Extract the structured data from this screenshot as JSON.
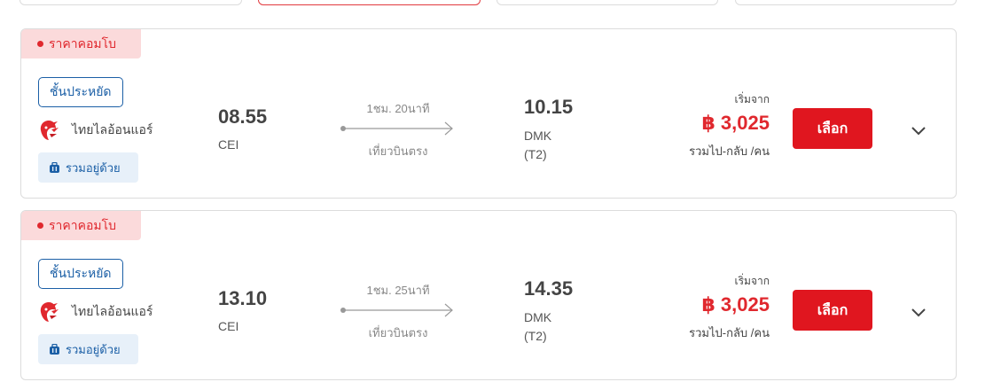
{
  "tabs": [
    {
      "state": "inactive"
    },
    {
      "state": "active"
    },
    {
      "state": "inactive"
    },
    {
      "state": "inactive"
    }
  ],
  "flights": [
    {
      "badge": "ราคาคอมโบ",
      "fare_class": "ชั้นประหยัด",
      "airline": "ไทยไลอ้อนแอร์",
      "airline_icon": "lion-air-logo",
      "baggage": "รวมอยู่ด้วย",
      "baggage_icon": "luggage-icon",
      "departure": {
        "time": "08.55",
        "code": "CEI"
      },
      "duration": "1ชม. 20นาที",
      "stops": "เที่ยวบินตรง",
      "arrival": {
        "time": "10.15",
        "code": "DMK",
        "terminal": "(T2)"
      },
      "price_from": "เริ่มจาก",
      "price": "฿ 3,025",
      "price_note": "รวมไป-กลับ /คน",
      "select_label": "เลือก"
    },
    {
      "badge": "ราคาคอมโบ",
      "fare_class": "ชั้นประหยัด",
      "airline": "ไทยไลอ้อนแอร์",
      "airline_icon": "lion-air-logo",
      "baggage": "รวมอยู่ด้วย",
      "baggage_icon": "luggage-icon",
      "departure": {
        "time": "13.10",
        "code": "CEI"
      },
      "duration": "1ชม. 25นาที",
      "stops": "เที่ยวบินตรง",
      "arrival": {
        "time": "14.35",
        "code": "DMK",
        "terminal": "(T2)"
      },
      "price_from": "เริ่มจาก",
      "price": "฿ 3,025",
      "price_note": "รวมไป-กลับ /คน",
      "select_label": "เลือก"
    }
  ],
  "colors": {
    "accent": "#e0161f",
    "badge_bg": "#fbdadb",
    "brand_blue": "#1b5fa6",
    "bag_bg": "#e7f0f9"
  }
}
